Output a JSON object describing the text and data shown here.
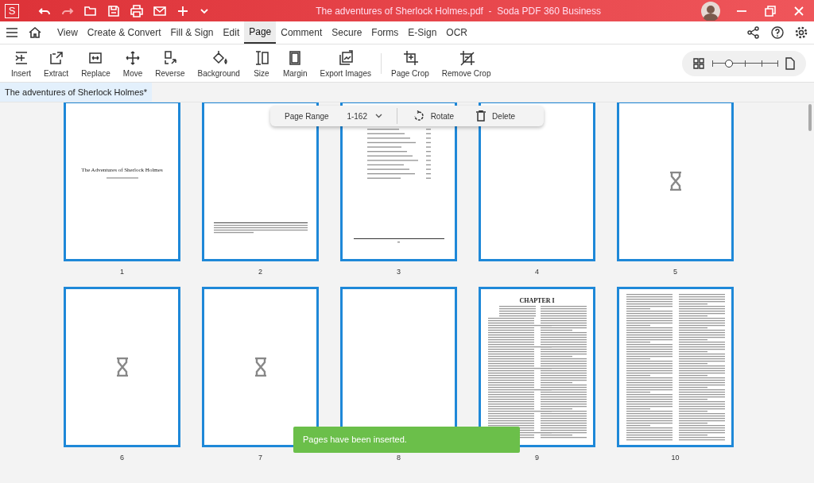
{
  "window": {
    "title": "The adventures of Sherlock Holmes.pdf  -  Soda PDF 360 Business",
    "logo": "S"
  },
  "menu": [
    {
      "label": "View",
      "selected": false
    },
    {
      "label": "Create & Convert",
      "selected": false
    },
    {
      "label": "Fill & Sign",
      "selected": false
    },
    {
      "label": "Edit",
      "selected": false
    },
    {
      "label": "Page",
      "selected": true
    },
    {
      "label": "Comment",
      "selected": false
    },
    {
      "label": "Secure",
      "selected": false
    },
    {
      "label": "Forms",
      "selected": false
    },
    {
      "label": "E-Sign",
      "selected": false
    },
    {
      "label": "OCR",
      "selected": false
    }
  ],
  "toolbar": [
    {
      "label": "Insert"
    },
    {
      "label": "Extract"
    },
    {
      "label": "Replace"
    },
    {
      "label": "Move"
    },
    {
      "label": "Reverse"
    },
    {
      "label": "Background"
    },
    {
      "label": "Size"
    },
    {
      "label": "Margin"
    },
    {
      "label": "Export Images"
    },
    {
      "label": "Page Crop"
    },
    {
      "label": "Remove Crop"
    }
  ],
  "zoom": {
    "level": 0.25
  },
  "document_tab": {
    "label": "The adventures of Sherlock Holmes*",
    "selected": true
  },
  "page_bar": {
    "label": "Page Range",
    "range": "1-162",
    "rotate": "Rotate",
    "delete": "Delete"
  },
  "pages": [
    {
      "number": "1",
      "kind": "title",
      "title": "The Adventures of Sherlock Holmes",
      "selected": true
    },
    {
      "number": "2",
      "kind": "notice",
      "selected": true
    },
    {
      "number": "3",
      "kind": "contents",
      "selected": true
    },
    {
      "number": "4",
      "kind": "blank",
      "selected": true
    },
    {
      "number": "5",
      "kind": "loading",
      "selected": true
    },
    {
      "number": "6",
      "kind": "loading",
      "selected": true
    },
    {
      "number": "7",
      "kind": "loading",
      "selected": true
    },
    {
      "number": "8",
      "kind": "blank",
      "selected": true
    },
    {
      "number": "9",
      "kind": "chapter",
      "title": "CHAPTER I",
      "selected": true
    },
    {
      "number": "10",
      "kind": "text",
      "selected": true
    }
  ],
  "toast": {
    "message": "Pages have been inserted."
  }
}
